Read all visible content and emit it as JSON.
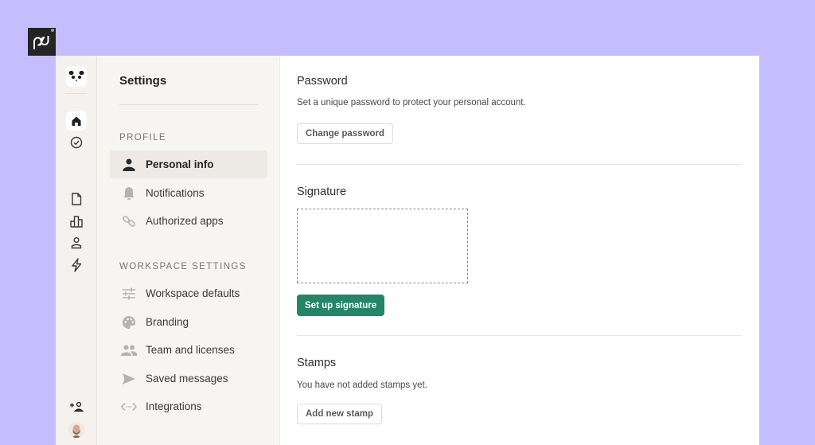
{
  "brand": {
    "logo_text": "pd",
    "logo_icon": "pandadoc-logo-icon"
  },
  "rail": {
    "workspace_icon": "panda-icon",
    "top_items": [
      {
        "name": "home",
        "icon": "home-icon",
        "active": true
      },
      {
        "name": "tasks",
        "icon": "check-circle-icon",
        "active": false
      }
    ],
    "middle_items": [
      {
        "name": "documents",
        "icon": "document-icon"
      },
      {
        "name": "reports",
        "icon": "bar-chart-icon"
      },
      {
        "name": "contacts",
        "icon": "user-icon"
      },
      {
        "name": "automations",
        "icon": "lightning-icon"
      }
    ],
    "bottom_items": [
      {
        "name": "invite",
        "icon": "add-user-icon"
      },
      {
        "name": "profile",
        "icon": "avatar-icon"
      }
    ]
  },
  "settings_nav": {
    "title": "Settings",
    "profile_section": {
      "label": "PROFILE",
      "items": [
        {
          "label": "Personal info",
          "icon": "person-icon",
          "active": true
        },
        {
          "label": "Notifications",
          "icon": "bell-icon",
          "active": false
        },
        {
          "label": "Authorized apps",
          "icon": "link-icon",
          "active": false
        }
      ]
    },
    "workspace_section": {
      "label": "WORKSPACE SETTINGS",
      "items": [
        {
          "label": "Workspace defaults",
          "icon": "sliders-icon"
        },
        {
          "label": "Branding",
          "icon": "palette-icon"
        },
        {
          "label": "Team and licenses",
          "icon": "team-icon"
        },
        {
          "label": "Saved messages",
          "icon": "send-icon"
        },
        {
          "label": "Integrations",
          "icon": "code-icon"
        }
      ]
    }
  },
  "content": {
    "password": {
      "title": "Password",
      "description": "Set a unique password to protect your personal account.",
      "button": "Change password"
    },
    "signature": {
      "title": "Signature",
      "button": "Set up signature"
    },
    "stamps": {
      "title": "Stamps",
      "description": "You have not added stamps yet.",
      "button": "Add new stamp"
    }
  },
  "colors": {
    "background": "#c6bdff",
    "primary": "#248567",
    "nav_bg": "#f7f5f2",
    "rail_bg": "#f4f1ee"
  }
}
